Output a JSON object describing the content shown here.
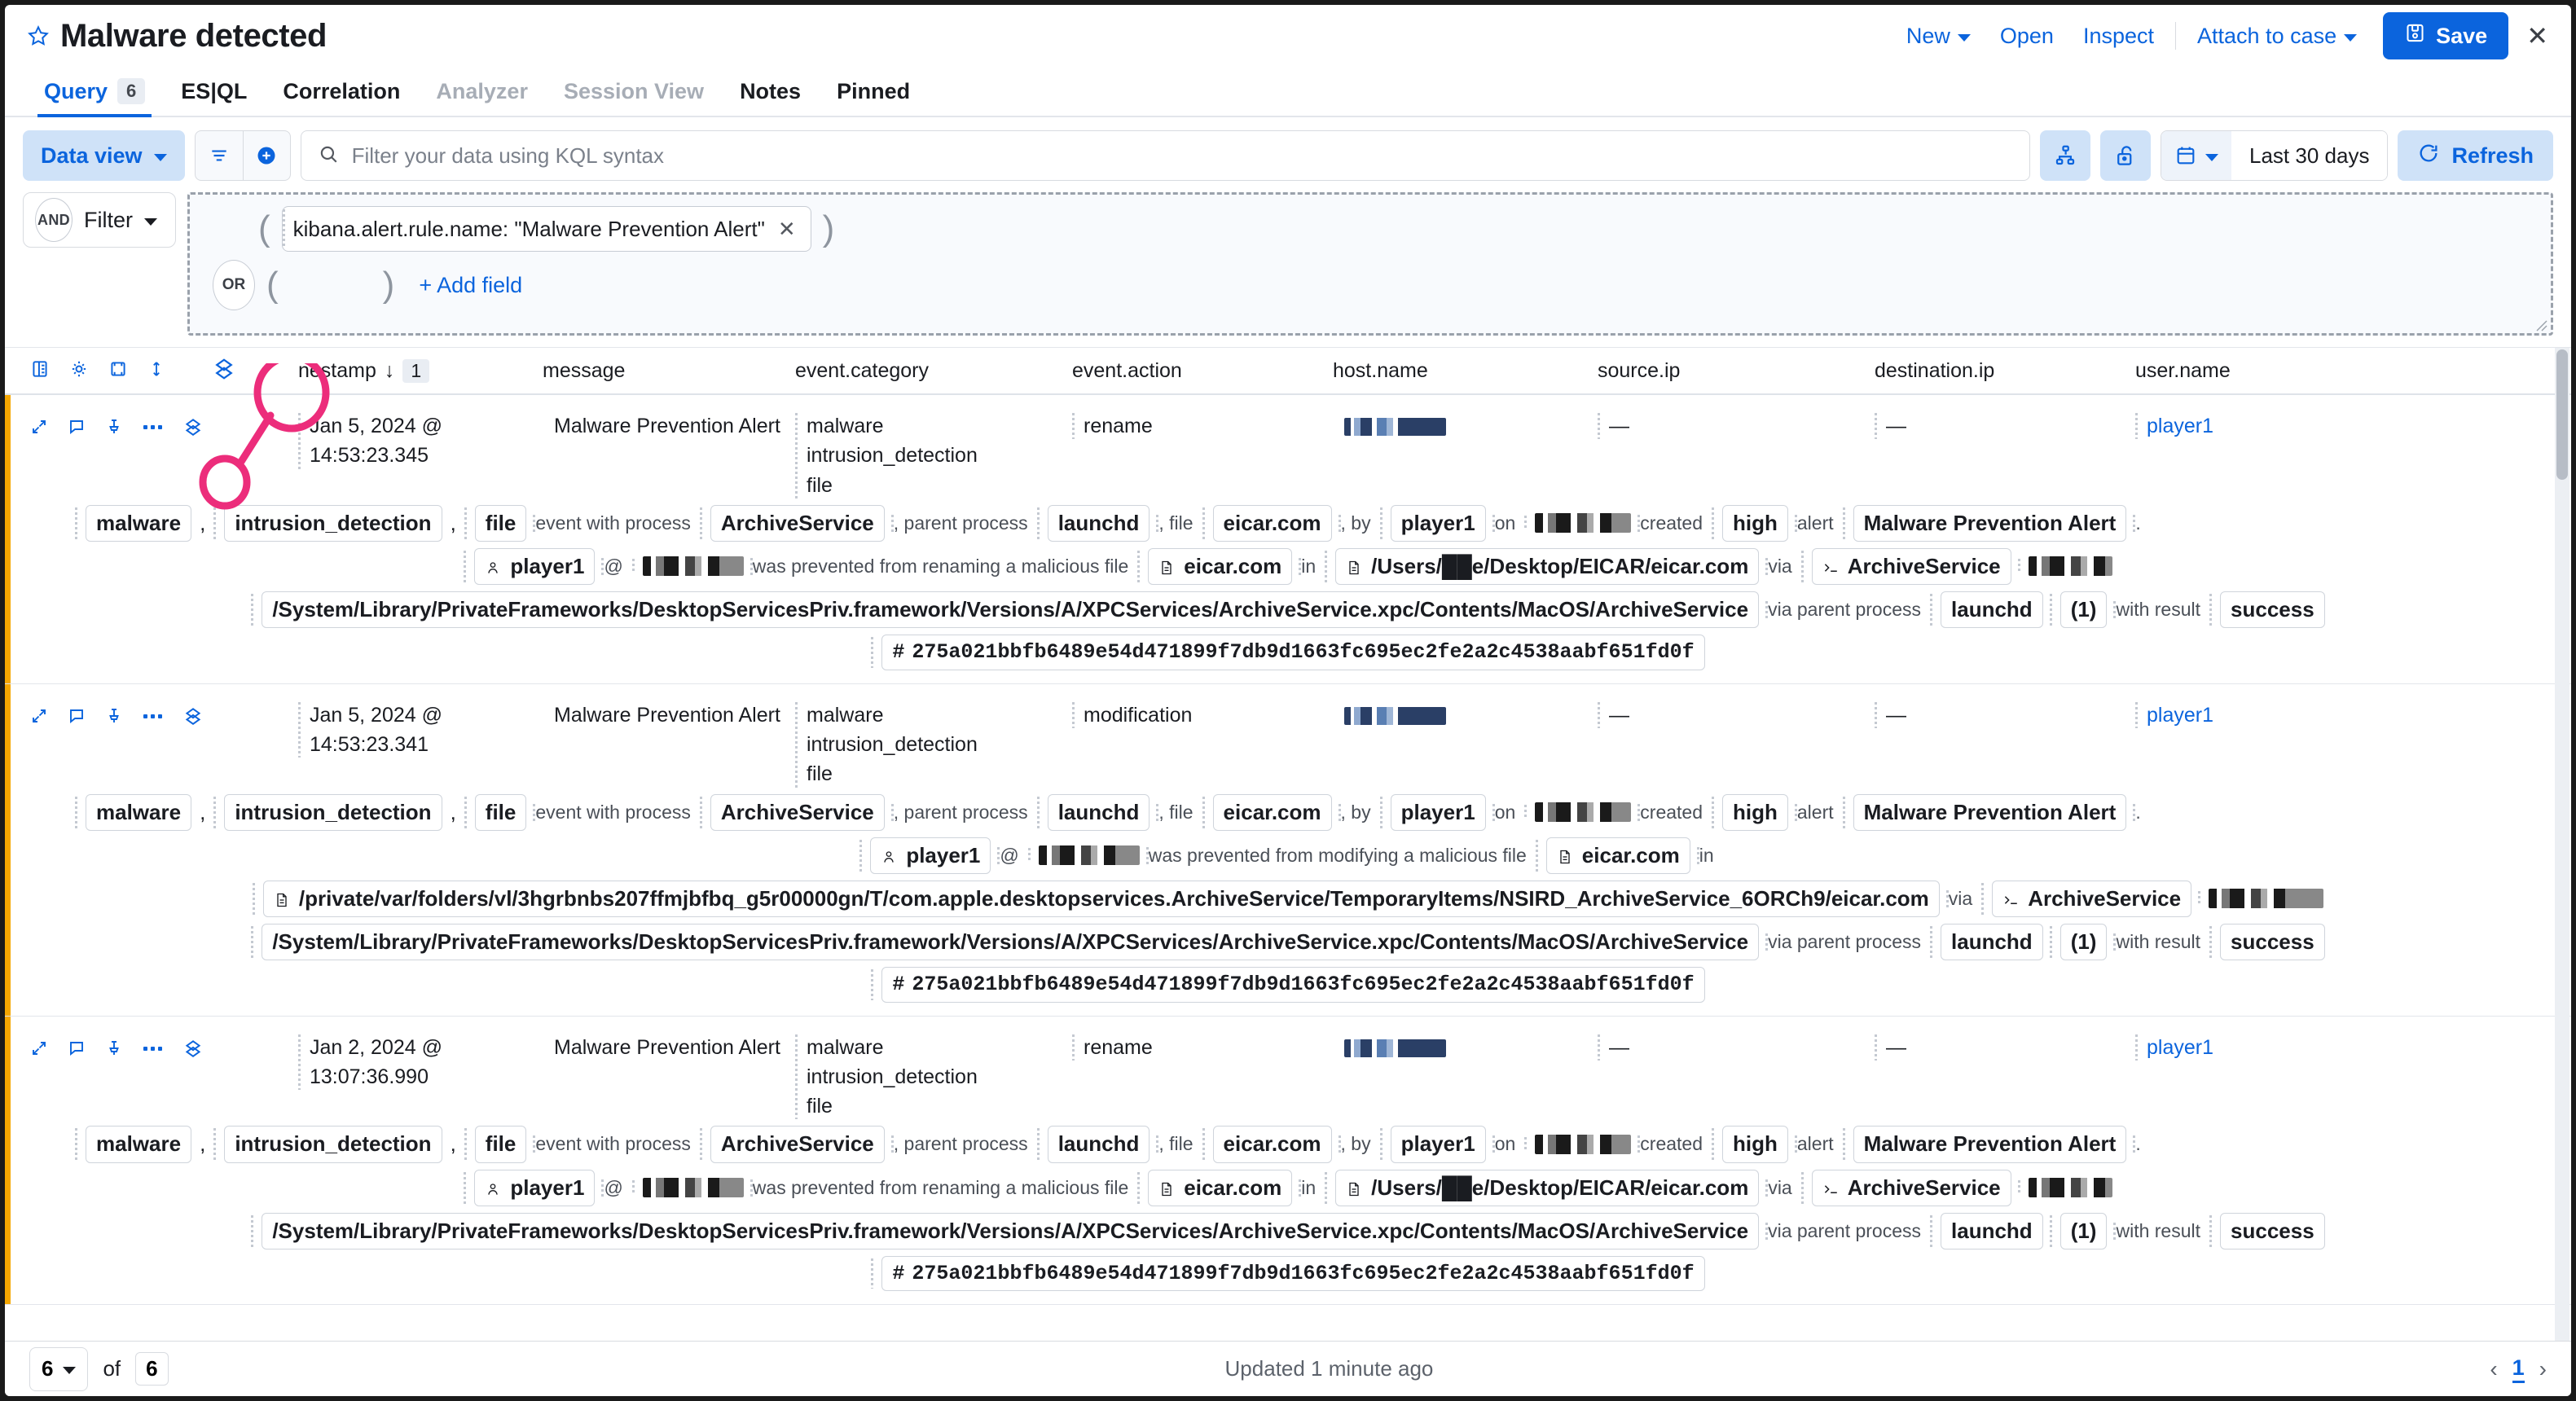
{
  "header": {
    "title": "Malware detected",
    "star_icon": "star-icon",
    "actions": [
      {
        "label": "New",
        "icon": "chevron-down-icon",
        "has_chevron": true
      },
      {
        "label": "Open",
        "has_chevron": false
      },
      {
        "label": "Inspect",
        "has_chevron": false
      },
      {
        "label": "Attach to case",
        "has_chevron": true
      }
    ],
    "save_label": "Save",
    "save_icon": "save-disk-icon",
    "close_icon": "close-icon",
    "accent_color": "#0b64dd"
  },
  "tabs": [
    {
      "label": "Query",
      "badge": "6",
      "state": "active"
    },
    {
      "label": "ES|QL",
      "state": "normal"
    },
    {
      "label": "Correlation",
      "state": "normal"
    },
    {
      "label": "Analyzer",
      "state": "disabled"
    },
    {
      "label": "Session View",
      "state": "disabled"
    },
    {
      "label": "Notes",
      "state": "normal"
    },
    {
      "label": "Pinned",
      "state": "normal"
    }
  ],
  "querybar": {
    "dataview_label": "Data view",
    "filter_icon": "filter-lines-icon",
    "add_filter_icon": "add-circle-icon",
    "search_icon": "search-icon",
    "search_placeholder": "Filter your data using KQL syntax",
    "saved_query_icon": "saved-query-icon",
    "unlock_icon": "unlock-icon",
    "calendar_icon": "calendar-icon",
    "time_range": "Last 30 days",
    "refresh_label": "Refresh",
    "refresh_icon": "refresh-icon"
  },
  "filterrow": {
    "bool_and": "AND",
    "filter_label": "Filter",
    "bool_or": "OR",
    "chip_text": "kibana.alert.rule.name: \"Malware Prevention Alert\"",
    "chip_remove_icon": "close-icon",
    "add_field_label": "+ Add field",
    "open_paren": "(",
    "close_paren": ")"
  },
  "table": {
    "tools": [
      "columns-icon",
      "gear-icon",
      "fullscreen-icon",
      "sort-icon"
    ],
    "expand_all_icon": "expand-details-icon",
    "columns": [
      {
        "key": "timestamp",
        "label": "nestamp",
        "sort": "desc",
        "sort_badge": "1"
      },
      {
        "key": "message",
        "label": "message"
      },
      {
        "key": "event_category",
        "label": "event.category"
      },
      {
        "key": "event_action",
        "label": "event.action"
      },
      {
        "key": "host_name",
        "label": "host.name"
      },
      {
        "key": "source_ip",
        "label": "source.ip"
      },
      {
        "key": "destination_ip",
        "label": "destination.ip"
      },
      {
        "key": "user_name",
        "label": "user.name"
      }
    ],
    "row_icons": [
      "expand-icon",
      "comment-icon",
      "pin-icon",
      "more-actions-icon",
      "details-icon"
    ],
    "rows": [
      {
        "timestamp": "Jan 5, 2024 @ 14:53:23.345",
        "message": "Malware Prevention Alert",
        "event_category": [
          "malware",
          "intrusion_detection",
          "file"
        ],
        "event_action": "rename",
        "host_name": "[redacted]",
        "source_ip": "—",
        "destination_ip": "—",
        "user_name": "player1",
        "summary": [
          {
            "t": "chip",
            "v": "malware"
          },
          {
            "t": "comma",
            "v": ","
          },
          {
            "t": "chip",
            "v": "intrusion_detection"
          },
          {
            "t": "comma",
            "v": ","
          },
          {
            "t": "chip",
            "v": "file"
          },
          {
            "t": "text",
            "v": "event with process"
          },
          {
            "t": "chip",
            "v": "ArchiveService"
          },
          {
            "t": "text",
            "v": ", parent process"
          },
          {
            "t": "chip",
            "v": "launchd"
          },
          {
            "t": "text",
            "v": ", file"
          },
          {
            "t": "chip",
            "v": "eicar.com"
          },
          {
            "t": "text",
            "v": ", by"
          },
          {
            "t": "chip",
            "v": "player1"
          },
          {
            "t": "text",
            "v": "on"
          },
          {
            "t": "redact",
            "v": ""
          },
          {
            "t": "text",
            "v": "created"
          },
          {
            "t": "chip",
            "v": "high"
          },
          {
            "t": "text",
            "v": "alert"
          },
          {
            "t": "chip",
            "v": "Malware Prevention Alert"
          },
          {
            "t": "text",
            "v": "."
          }
        ],
        "reason": [
          {
            "t": "chip-user",
            "v": "player1"
          },
          {
            "t": "text",
            "v": "@"
          },
          {
            "t": "redact",
            "v": ""
          },
          {
            "t": "text",
            "v": "was prevented from renaming a malicious file"
          },
          {
            "t": "chip-file",
            "v": "eicar.com"
          },
          {
            "t": "text",
            "v": "in"
          },
          {
            "t": "chip-file",
            "v": "/Users/██e/Desktop/EICAR/eicar.com"
          },
          {
            "t": "text",
            "v": "via"
          },
          {
            "t": "chip-proc",
            "v": "ArchiveService"
          },
          {
            "t": "redact",
            "v": ""
          }
        ],
        "reason2": [
          {
            "t": "chip",
            "v": "/System/Library/PrivateFrameworks/DesktopServicesPriv.framework/Versions/A/XPCServices/ArchiveService.xpc/Contents/MacOS/ArchiveService"
          },
          {
            "t": "text",
            "v": "via parent process"
          },
          {
            "t": "chip",
            "v": "launchd"
          },
          {
            "t": "chip",
            "v": "(1)"
          },
          {
            "t": "text",
            "v": "with result"
          },
          {
            "t": "chip",
            "v": "success"
          }
        ],
        "hash": "275a021bbfb6489e54d471899f7db9d1663fc695ec2fe2a2c4538aabf651fd0f"
      },
      {
        "timestamp": "Jan 5, 2024 @ 14:53:23.341",
        "message": "Malware Prevention Alert",
        "event_category": [
          "malware",
          "intrusion_detection",
          "file"
        ],
        "event_action": "modification",
        "host_name": "[redacted]",
        "source_ip": "—",
        "destination_ip": "—",
        "user_name": "player1",
        "summary": [
          {
            "t": "chip",
            "v": "malware"
          },
          {
            "t": "comma",
            "v": ","
          },
          {
            "t": "chip",
            "v": "intrusion_detection"
          },
          {
            "t": "comma",
            "v": ","
          },
          {
            "t": "chip",
            "v": "file"
          },
          {
            "t": "text",
            "v": "event with process"
          },
          {
            "t": "chip",
            "v": "ArchiveService"
          },
          {
            "t": "text",
            "v": ", parent process"
          },
          {
            "t": "chip",
            "v": "launchd"
          },
          {
            "t": "text",
            "v": ", file"
          },
          {
            "t": "chip",
            "v": "eicar.com"
          },
          {
            "t": "text",
            "v": ", by"
          },
          {
            "t": "chip",
            "v": "player1"
          },
          {
            "t": "text",
            "v": "on"
          },
          {
            "t": "redact",
            "v": ""
          },
          {
            "t": "text",
            "v": "created"
          },
          {
            "t": "chip",
            "v": "high"
          },
          {
            "t": "text",
            "v": "alert"
          },
          {
            "t": "chip",
            "v": "Malware Prevention Alert"
          },
          {
            "t": "text",
            "v": "."
          }
        ],
        "reason": [
          {
            "t": "chip-user",
            "v": "player1"
          },
          {
            "t": "text",
            "v": "@"
          },
          {
            "t": "redact",
            "v": ""
          },
          {
            "t": "text",
            "v": "was prevented from modifying a malicious file"
          },
          {
            "t": "chip-file",
            "v": "eicar.com"
          },
          {
            "t": "text",
            "v": "in"
          }
        ],
        "reason2": [
          {
            "t": "chip-file",
            "v": "/private/var/folders/vl/3hgrbnbs207ffmjbfbq_g5r00000gn/T/com.apple.desktopservices.ArchiveService/TemporaryItems/NSIRD_ArchiveService_6ORCh9/eicar.com"
          },
          {
            "t": "text",
            "v": "via"
          },
          {
            "t": "chip-proc",
            "v": "ArchiveService"
          },
          {
            "t": "redact",
            "v": ""
          }
        ],
        "reason3": [
          {
            "t": "chip",
            "v": "/System/Library/PrivateFrameworks/DesktopServicesPriv.framework/Versions/A/XPCServices/ArchiveService.xpc/Contents/MacOS/ArchiveService"
          },
          {
            "t": "text",
            "v": "via parent process"
          },
          {
            "t": "chip",
            "v": "launchd"
          },
          {
            "t": "chip",
            "v": "(1)"
          },
          {
            "t": "text",
            "v": "with result"
          },
          {
            "t": "chip",
            "v": "success"
          }
        ],
        "hash": "275a021bbfb6489e54d471899f7db9d1663fc695ec2fe2a2c4538aabf651fd0f"
      },
      {
        "timestamp": "Jan 2, 2024 @ 13:07:36.990",
        "message": "Malware Prevention Alert",
        "event_category": [
          "malware",
          "intrusion_detection",
          "file"
        ],
        "event_action": "rename",
        "host_name": "[redacted]",
        "source_ip": "—",
        "destination_ip": "—",
        "user_name": "player1",
        "summary": [
          {
            "t": "chip",
            "v": "malware"
          },
          {
            "t": "comma",
            "v": ","
          },
          {
            "t": "chip",
            "v": "intrusion_detection"
          },
          {
            "t": "comma",
            "v": ","
          },
          {
            "t": "chip",
            "v": "file"
          },
          {
            "t": "text",
            "v": "event with process"
          },
          {
            "t": "chip",
            "v": "ArchiveService"
          },
          {
            "t": "text",
            "v": ", parent process"
          },
          {
            "t": "chip",
            "v": "launchd"
          },
          {
            "t": "text",
            "v": ", file"
          },
          {
            "t": "chip",
            "v": "eicar.com"
          },
          {
            "t": "text",
            "v": ", by"
          },
          {
            "t": "chip",
            "v": "player1"
          },
          {
            "t": "text",
            "v": "on"
          },
          {
            "t": "redact",
            "v": ""
          },
          {
            "t": "text",
            "v": "created"
          },
          {
            "t": "chip",
            "v": "high"
          },
          {
            "t": "text",
            "v": "alert"
          },
          {
            "t": "chip",
            "v": "Malware Prevention Alert"
          },
          {
            "t": "text",
            "v": "."
          }
        ],
        "reason": [
          {
            "t": "chip-user",
            "v": "player1"
          },
          {
            "t": "text",
            "v": "@"
          },
          {
            "t": "redact",
            "v": ""
          },
          {
            "t": "text",
            "v": "was prevented from renaming a malicious file"
          },
          {
            "t": "chip-file",
            "v": "eicar.com"
          },
          {
            "t": "text",
            "v": "in"
          },
          {
            "t": "chip-file",
            "v": "/Users/██e/Desktop/EICAR/eicar.com"
          },
          {
            "t": "text",
            "v": "via"
          },
          {
            "t": "chip-proc",
            "v": "ArchiveService"
          },
          {
            "t": "redact",
            "v": ""
          }
        ],
        "reason2": [
          {
            "t": "chip",
            "v": "/System/Library/PrivateFrameworks/DesktopServicesPriv.framework/Versions/A/XPCServices/ArchiveService.xpc/Contents/MacOS/ArchiveService"
          },
          {
            "t": "text",
            "v": "via parent process"
          },
          {
            "t": "chip",
            "v": "launchd"
          },
          {
            "t": "chip",
            "v": "(1)"
          },
          {
            "t": "text",
            "v": "with result"
          },
          {
            "t": "chip",
            "v": "success"
          }
        ],
        "hash": "275a021bbfb6489e54d471899f7db9d1663fc695ec2fe2a2c4538aabf651fd0f"
      }
    ]
  },
  "footer": {
    "per_page": "6",
    "of_label": "of",
    "total": "6",
    "updated": "Updated 1 minute ago",
    "prev_icon": "chevron-left-icon",
    "page": "1",
    "next_icon": "chevron-right-icon"
  },
  "annotation": {
    "color": "#ec2d7b",
    "target_icon": "details-icon"
  }
}
